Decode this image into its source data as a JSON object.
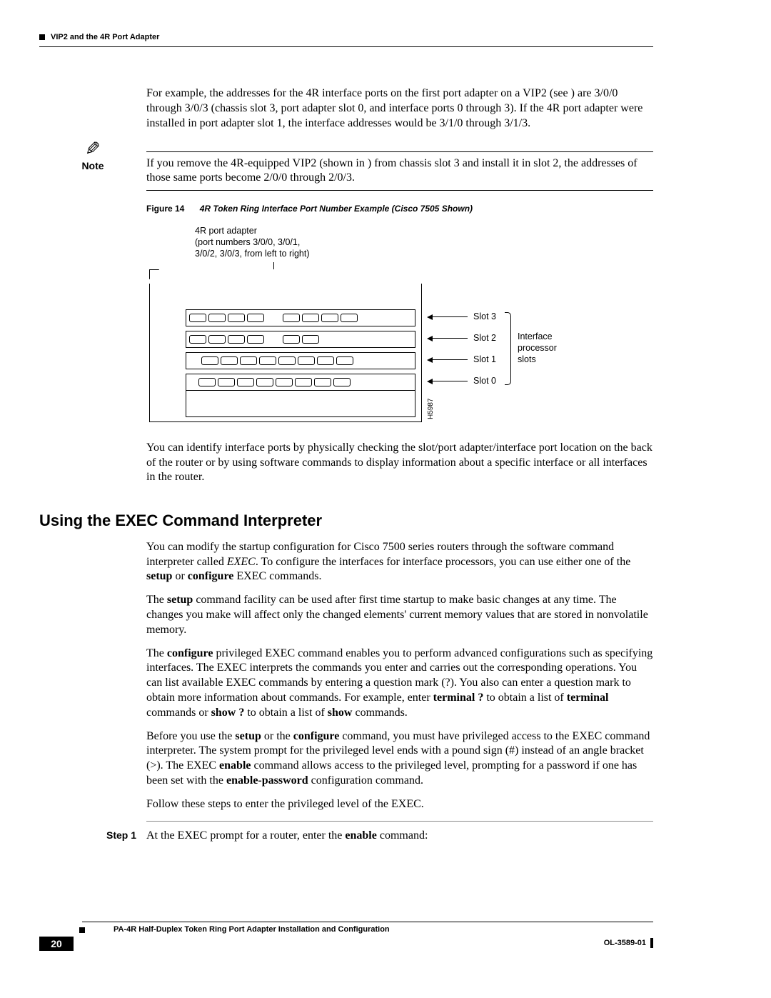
{
  "header": {
    "section": "VIP2 and the 4R Port Adapter"
  },
  "p1": "For example, the addresses for the 4R interface ports on the first port adapter on a VIP2 (see ) are 3/0/0 through 3/0/3 (chassis slot 3, port adapter slot 0, and interface ports 0 through 3). If the 4R port adapter were installed in port adapter slot 1, the interface addresses would be 3/1/0 through 3/1/3.",
  "note": {
    "label": "Note",
    "text": "If you remove the 4R-equipped VIP2 (shown in ) from chassis slot 3 and install it in slot 2, the addresses of those same ports become 2/0/0 through 2/0/3."
  },
  "figure": {
    "label": "Figure 14",
    "title": "4R Token Ring Interface Port Number Example (Cisco 7505 Shown)",
    "callout_top": "4R port adapter\n(port numbers 3/0/0, 3/0/1,\n3/0/2, 3/0/3, from left to right)",
    "slots": [
      "Slot 3",
      "Slot 2",
      "Slot 1",
      "Slot 0"
    ],
    "side": "Interface\nprocessor\nslots",
    "code": "H5987"
  },
  "p2": "You can identify interface ports by physically checking the slot/port adapter/interface port location on the back of the router or by using software commands to display information about a specific interface or all interfaces in the router.",
  "h2": "Using the EXEC Command Interpreter",
  "exec": {
    "p1a": "You can modify the startup configuration for Cisco 7500 series routers through the software command interpreter called ",
    "p1b": "EXEC",
    "p1c": ". To configure the interfaces for interface processors, you can use either one of the ",
    "p1d": "setup",
    "p1e": " or ",
    "p1f": "configure",
    "p1g": " EXEC commands.",
    "p2a": "The ",
    "p2b": "setup",
    "p2c": " command facility can be used after first time startup to make basic changes at any time. The changes you make will affect only the changed elements' current memory values that are stored in nonvolatile memory.",
    "p3a": "The ",
    "p3b": "configure",
    "p3c": " privileged EXEC command enables you to perform advanced configurations such as specifying interfaces. The EXEC interprets the commands you enter and carries out the corresponding operations. You can list available EXEC commands by entering a question mark (?). You also can enter a question mark to obtain more information about commands. For example, enter ",
    "p3d": "terminal ?",
    "p3e": " to obtain a list of ",
    "p3f": "terminal",
    "p3g": " commands or ",
    "p3h": "show ?",
    "p3i": " to obtain a list of ",
    "p3j": "show",
    "p3k": " commands.",
    "p4a": "Before you use the ",
    "p4b": "setup",
    "p4c": " or the ",
    "p4d": "configure",
    "p4e": " command, you must have privileged access to the EXEC command interpreter. The system prompt for the privileged level ends with a pound sign (#) instead of an angle bracket (>). The EXEC ",
    "p4f": "enable",
    "p4g": " command allows access to the privileged level, prompting for a password if one has been set with the ",
    "p4h": "enable-password",
    "p4i": " configuration command.",
    "p5": "Follow these steps to enter the privileged level of the EXEC."
  },
  "step": {
    "label": "Step 1",
    "text_a": "At the EXEC prompt for a router, enter the ",
    "text_b": "enable",
    "text_c": " command:"
  },
  "footer": {
    "title": "PA-4R Half-Duplex Token Ring Port Adapter Installation and Configuration",
    "page": "20",
    "doc": "OL-3589-01"
  }
}
